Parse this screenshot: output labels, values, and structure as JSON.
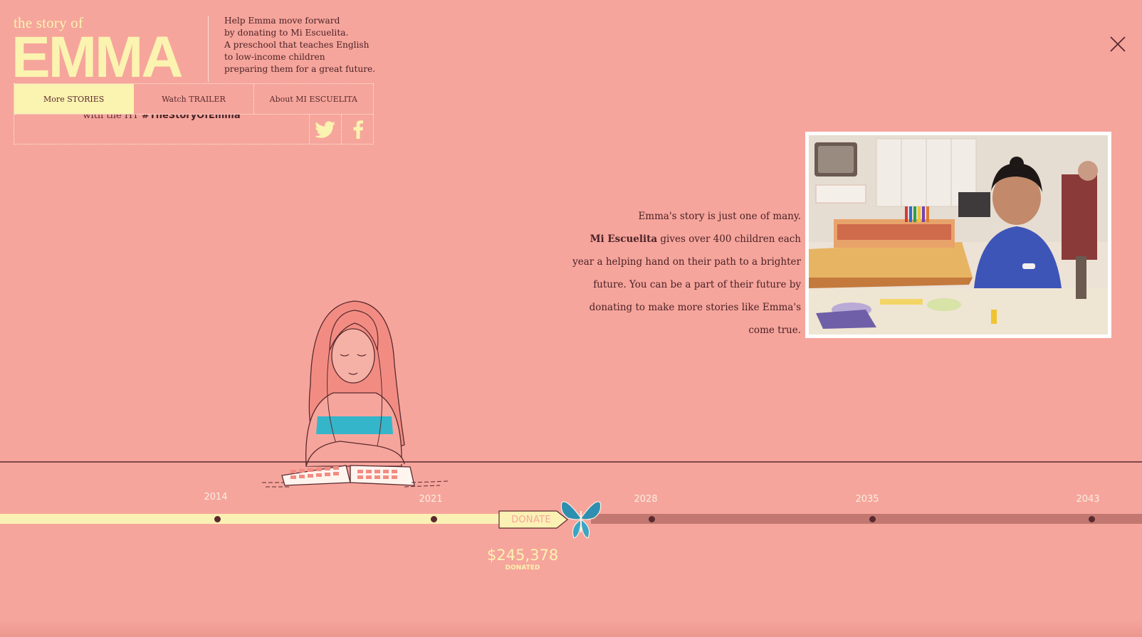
{
  "brand": {
    "small": "the story of",
    "big": "EMMA"
  },
  "intro": "Help Emma move forward\nby donating to Mi Escuelita.\nA preschool that teaches English\nto low-income children\npreparing them for a great future.",
  "nav": {
    "items": [
      {
        "label": "More STORIES",
        "active": true
      },
      {
        "label": "Watch TRAILER",
        "active": false
      },
      {
        "label": "About MI ESCUELITA",
        "active": false
      }
    ]
  },
  "share": {
    "prefix": "with the HT ",
    "hashtag": "#TheStoryOfEmma"
  },
  "icons": {
    "twitter": "twitter-icon",
    "facebook": "facebook-icon",
    "close": "close-icon",
    "butterfly": "butterfly-icon"
  },
  "story": {
    "line1": "Emma's story is just one of many.",
    "org": "Mi Escuelita",
    "line2": " gives over 400 children each year a helping hand on their path to a brighter future. You can be a part of their future by donating to make more stories like Emma's come true."
  },
  "timeline": {
    "years": [
      "2014",
      "2021",
      "2028",
      "2035",
      "2043"
    ],
    "donate_label": "DONATE",
    "amount": "$245,378",
    "amount_label": "DONATED"
  },
  "colors": {
    "background": "#f6a59c",
    "cream": "#fbf3b0",
    "dark": "#5a2a2e",
    "future_track": "#c27871",
    "butterfly": "#2f8fb0"
  }
}
